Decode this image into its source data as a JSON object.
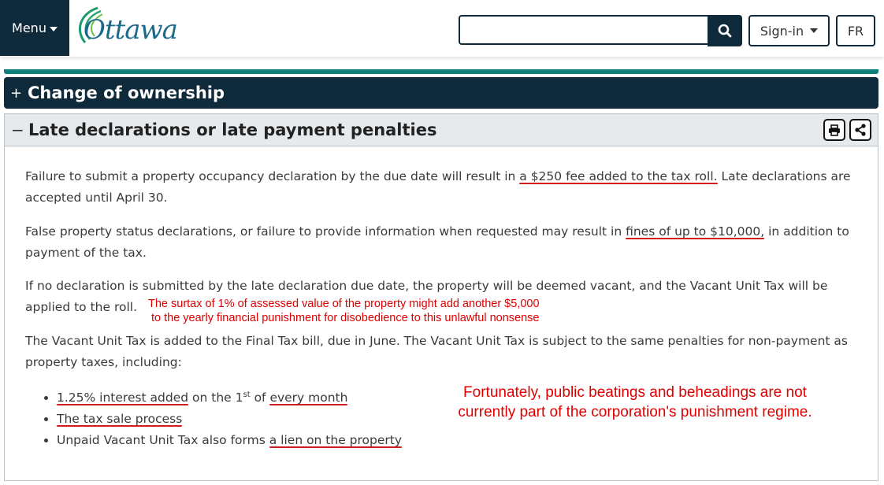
{
  "header": {
    "menu_label": "Menu",
    "logo_text": "Ottawa",
    "search": {
      "placeholder": "",
      "value": ""
    },
    "signin_label": "Sign-in",
    "lang_label": "FR"
  },
  "accordion": {
    "collapsed": {
      "sign": "+",
      "title": "Change of ownership"
    },
    "expanded": {
      "sign": "−",
      "title": "Late declarations or late payment penalties"
    }
  },
  "content": {
    "p1_a": "Failure to submit a property occupancy declaration by the due date will result in ",
    "p1_hl": "a $250 fee added to the tax roll.",
    "p1_b": " Late declarations are accepted until April 30.",
    "p2_a": "False property status declarations, or failure to provide information when requested may result in ",
    "p2_hl": "fines of up to $10,000,",
    "p2_b": " in addition to payment of the tax.",
    "p3_a": "If no declaration is submitted by the late declaration due date, the property will be deemed vacant, and the Vacant Unit Tax will be",
    "p3_b": "applied to the roll.",
    "p4": "The Vacant Unit Tax is added to the Final Tax bill, due in June. The Vacant Unit Tax is subject to the same penalties for non-payment as property taxes, including:",
    "list": {
      "item1_hl1": "1.25% interest added",
      "item1_mid": " on the 1",
      "item1_sup": "st",
      "item1_of": " of ",
      "item1_hl2": "every month",
      "item2_hl": "The tax sale process",
      "item3_a": "Unpaid Vacant Unit Tax also forms ",
      "item3_hl": "a lien on the property"
    }
  },
  "annotations": {
    "note1_line1": "The surtax of 1% of assessed value of the property might add another $5,000",
    "note1_line2": "to the yearly financial punishment for disobedience to this unlawful nonsense",
    "note2_line1": "Fortunately, public beatings and beheadings are not",
    "note2_line2": "currently part of the corporation's punishment regime."
  },
  "colors": {
    "navy": "#0f2a3a",
    "teal": "#11807a",
    "annotation_red": "#e00000"
  },
  "icons": {
    "search": "search-icon",
    "print": "print-icon",
    "share": "share-icon"
  }
}
